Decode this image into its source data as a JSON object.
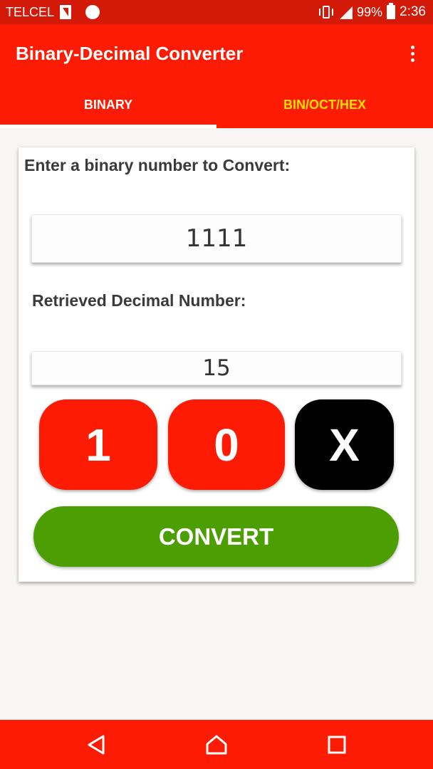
{
  "status_bar": {
    "carrier": "TELCEL",
    "battery": "99%",
    "time": "2:36",
    "icons": [
      "sim-icon",
      "notification-dot-icon",
      "vibrate-icon",
      "signal-icon",
      "battery-icon"
    ]
  },
  "app_bar": {
    "title": "Binary-Decimal Converter",
    "menu_icon": "overflow-menu-icon"
  },
  "tabs": [
    {
      "label": "BINARY",
      "active": true
    },
    {
      "label": "BIN/OCT/HEX",
      "active": false
    }
  ],
  "converter": {
    "input_label": "Enter a binary number to Convert:",
    "input_value": "1111",
    "output_label": "Retrieved Decimal Number:",
    "output_value": "15",
    "keys": {
      "one": "1",
      "zero": "0",
      "clear": "X"
    },
    "convert_label": "CONVERT"
  },
  "nav_bar": {
    "icons": [
      "back-icon",
      "home-icon",
      "recents-icon"
    ]
  },
  "colors": {
    "primary": "#fe1b03",
    "status_bar": "#d31a09",
    "tab_inactive": "#ffe000",
    "convert": "#4c9e02",
    "clear_key": "#000000"
  }
}
